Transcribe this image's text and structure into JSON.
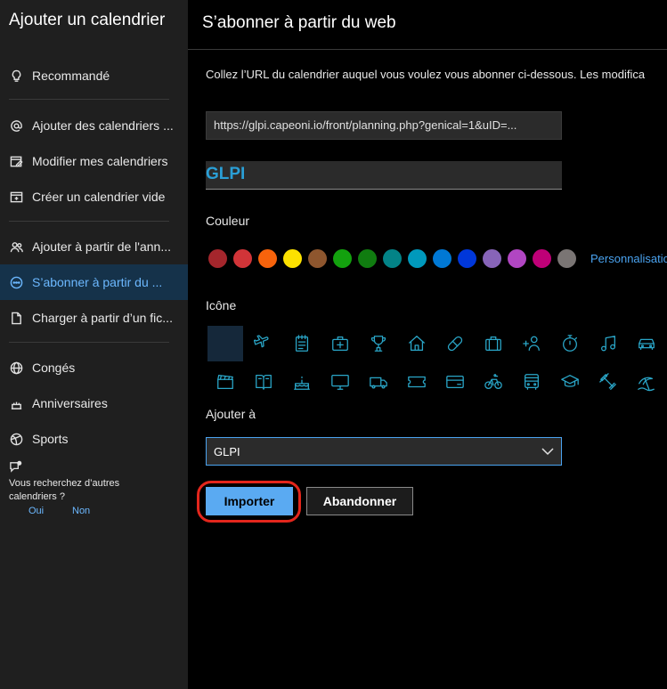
{
  "sidebar": {
    "title": "Ajouter un calendrier",
    "items": [
      {
        "label": "Recommandé",
        "icon": "lightbulb-icon"
      },
      {
        "label": "Ajouter des calendriers ...",
        "icon": "at-icon"
      },
      {
        "label": "Modifier mes calendriers",
        "icon": "edit-calendar-icon"
      },
      {
        "label": "Créer un calendrier vide",
        "icon": "calendar-add-icon"
      },
      {
        "label": "Ajouter à partir de l'ann...",
        "icon": "people-icon"
      },
      {
        "label": "S’abonner à partir du ...",
        "icon": "link-icon",
        "active": true
      },
      {
        "label": "Charger à partir d’un fic...",
        "icon": "file-upload-icon"
      },
      {
        "label": "Congés",
        "icon": "globe-icon"
      },
      {
        "label": "Anniversaires",
        "icon": "cake-icon"
      },
      {
        "label": "Sports",
        "icon": "ball-icon"
      }
    ],
    "feedback": {
      "question": "Vous recherchez d’autres calendriers ?",
      "yes": "Oui",
      "no": "Non"
    }
  },
  "main": {
    "title": "S’abonner à partir du web",
    "instructions": "Collez l’URL du calendrier auquel vous voulez vous abonner ci-dessous. Les modifica",
    "url_value": "https://glpi.capeoni.io/front/planning.php?genical=1&uID=...",
    "name_value": "GLPI",
    "color_label": "Couleur",
    "colors": [
      "#a4262c",
      "#d13438",
      "#f7630c",
      "#fce100",
      "#8e562e",
      "#13a10e",
      "#107c10",
      "#038387",
      "#0099bc",
      "#0078d4",
      "#0037da",
      "#8764b8",
      "#b146c2",
      "#bf0077",
      "#7a7574"
    ],
    "custom_link": "Personnalisation",
    "icon_label": "Icône",
    "icons": [
      "blank-icon",
      "airplane-icon",
      "notepad-icon",
      "medical-kit-icon",
      "trophy-icon",
      "home-icon",
      "pill-icon",
      "briefcase-icon",
      "people-icon",
      "stopwatch-icon",
      "music-note-icon",
      "car-icon",
      "clapperboard-icon",
      "book-icon",
      "birthday-cake-icon",
      "monitor-icon",
      "truck-icon",
      "ticket-icon",
      "credit-card-icon",
      "bicycle-icon",
      "bus-icon",
      "graduation-cap-icon",
      "dumbbell-icon",
      "beach-icon"
    ],
    "add_to_label": "Ajouter à",
    "calendar_selected": "GLPI",
    "import_label": "Importer",
    "cancel_label": "Abandonner",
    "accent_color": "#5aaaf2",
    "highlight_color": "#e3261c"
  }
}
